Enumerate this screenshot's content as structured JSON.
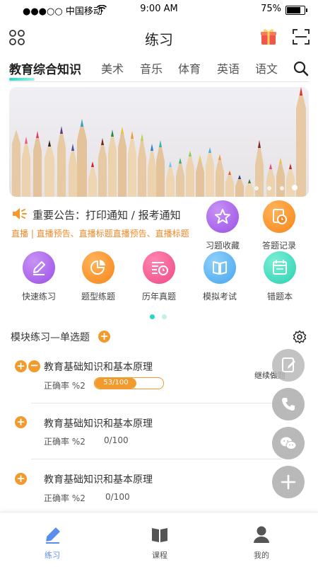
{
  "status_bar": {
    "carrier": "●●●○○ 中国移动",
    "time": "9:00 AM",
    "battery": "75%"
  },
  "nav": {
    "title": "练习",
    "left_icon": "grid-icon",
    "gift_icon": "gift-icon",
    "scan_icon": "scan-icon"
  },
  "tabs": [
    {
      "label": "教育综合知识",
      "active": true
    },
    {
      "label": "美术"
    },
    {
      "label": "音乐"
    },
    {
      "label": "体育"
    },
    {
      "label": "英语"
    },
    {
      "label": "语文"
    }
  ],
  "banner": {
    "slides": 4,
    "current": 4
  },
  "notice": {
    "text": "重要公告：打印通知 / 报考通知",
    "sub": "直播 | 直播预告、直播标题直播预告、直播标题"
  },
  "side_actions": [
    {
      "label": "习题收藏",
      "icon": "star-icon",
      "color": "#a05ce8"
    },
    {
      "label": "答题记录",
      "icon": "clock-record-icon",
      "color": "#f7931e"
    }
  ],
  "functions": [
    {
      "label": "快速练习",
      "icon": "pencil-icon",
      "color": "#a05ce8"
    },
    {
      "label": "题型练题",
      "icon": "pie-icon",
      "color": "#f7931e"
    },
    {
      "label": "历年真题",
      "icon": "list-clock-icon",
      "color": "#f2508e"
    },
    {
      "label": "模拟考试",
      "icon": "book-icon",
      "color": "#4aaef0"
    },
    {
      "label": "错题本",
      "icon": "calendar-icon",
      "color": "#2ed3b7"
    }
  ],
  "section": {
    "title": "模块练习—单选题",
    "continue_label": "继续做题"
  },
  "rows": [
    {
      "title": "教育基础知识和基本原理",
      "accuracy": "正确率 %2",
      "progress": "53/100",
      "progress_fraction": 0.53
    },
    {
      "title": "教育基础知识和基本原理",
      "accuracy": "正确率 %2",
      "progress": "0/100"
    },
    {
      "title": "教育基础知识和基本原理",
      "accuracy": "正确率 %2",
      "progress": "0/100"
    }
  ],
  "bottom_nav": [
    {
      "label": "练习",
      "icon": "pencil-icon",
      "active": true
    },
    {
      "label": "课程",
      "icon": "book-icon"
    },
    {
      "label": "我的",
      "icon": "user-icon"
    }
  ],
  "colors": {
    "accent": "#f39a2c",
    "teal": "#2ad6c5",
    "active_tab": "#5b8def"
  }
}
